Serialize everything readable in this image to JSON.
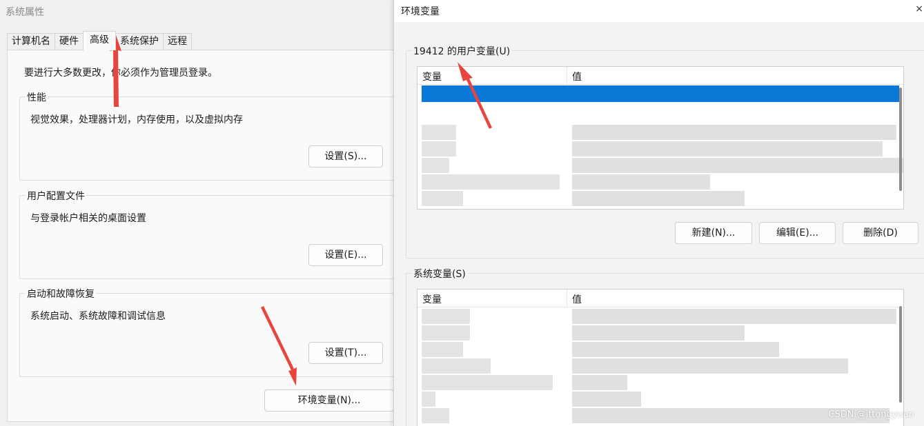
{
  "system_properties": {
    "title": "系统属性",
    "tabs": [
      {
        "label": "计算机名"
      },
      {
        "label": "硬件"
      },
      {
        "label": "高级"
      },
      {
        "label": "系统保护"
      },
      {
        "label": "远程"
      }
    ],
    "active_tab": "高级",
    "admin_note": "要进行大多数更改，你必须作为管理员登录。",
    "performance": {
      "title": "性能",
      "desc": "视觉效果，处理器计划，内存使用，以及虚拟内存",
      "button": "设置(S)..."
    },
    "user_profiles": {
      "title": "用户配置文件",
      "desc": "与登录帐户相关的桌面设置",
      "button": "设置(E)..."
    },
    "startup_recovery": {
      "title": "启动和故障恢复",
      "desc": "系统启动、系统故障和调试信息",
      "button": "设置(T)..."
    },
    "env_button": "环境变量(N)..."
  },
  "env_variables": {
    "title": "环境变量",
    "close_glyph": "×",
    "user_section": {
      "title": "19412 的用户变量(U)",
      "col_variable": "变量",
      "col_value": "值",
      "buttons": {
        "new": "新建(N)...",
        "edit": "编辑(E)...",
        "delete": "删除(D)"
      }
    },
    "system_section": {
      "title": "系统变量(S)",
      "col_variable": "变量",
      "col_value": "值"
    }
  },
  "watermark": "CSDN @ittongyuan",
  "colors": {
    "selection": "#0a78d7",
    "annotation_arrow": "#e8453c"
  }
}
